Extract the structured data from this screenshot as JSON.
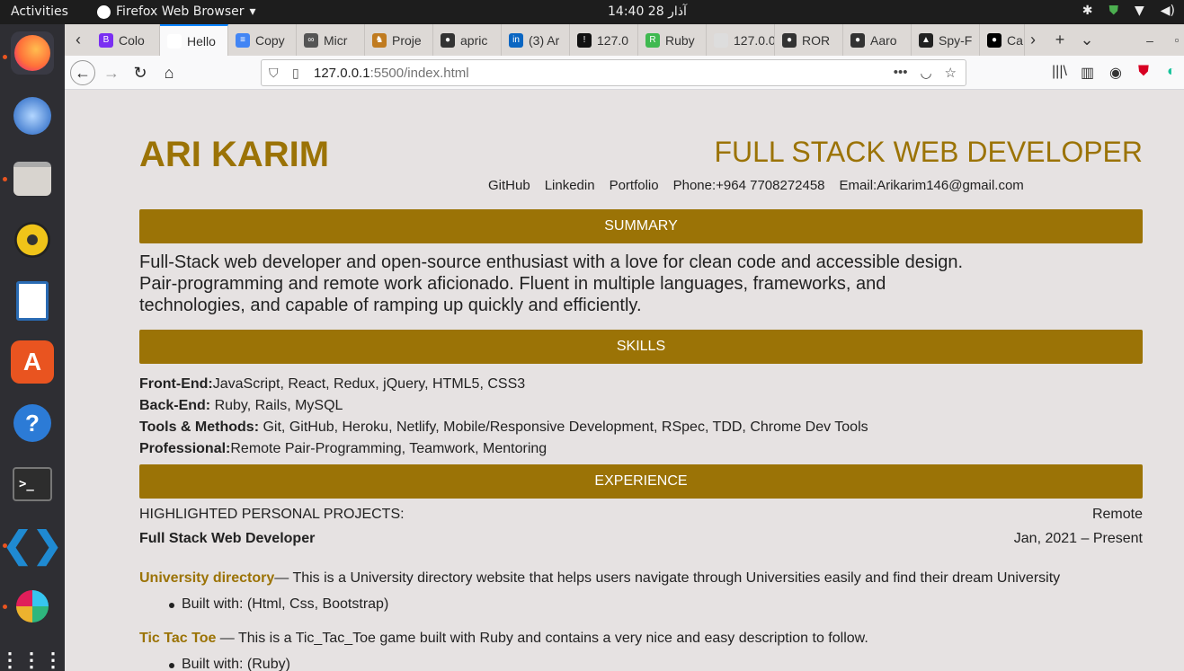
{
  "system_bar": {
    "activities": "Activities",
    "app_name": "Firefox Web Browser",
    "clock": "14:40  28 آذار"
  },
  "tabs": [
    {
      "label": "Colo",
      "color": "#7a2ff2",
      "glyph": "B"
    },
    {
      "label": "Hello",
      "color": "#ffffff",
      "glyph": ""
    },
    {
      "label": "Copy",
      "color": "#4285f4",
      "glyph": "≡"
    },
    {
      "label": "Micr",
      "color": "#555555",
      "glyph": "∞"
    },
    {
      "label": "Proje",
      "color": "#c07b20",
      "glyph": "♞"
    },
    {
      "label": "apric",
      "color": "#333333",
      "glyph": "●"
    },
    {
      "label": "(3) Ar",
      "color": "#0a66c2",
      "glyph": "in"
    },
    {
      "label": "127.0",
      "color": "#111111",
      "glyph": "!"
    },
    {
      "label": "Ruby",
      "color": "#3fb950",
      "glyph": "R"
    },
    {
      "label": "127.0.0.",
      "color": "#dddddd",
      "glyph": ""
    },
    {
      "label": "ROR",
      "color": "#333333",
      "glyph": "●"
    },
    {
      "label": "Aaro",
      "color": "#333333",
      "glyph": "●"
    },
    {
      "label": "Spy-F",
      "color": "#222222",
      "glyph": "▲"
    },
    {
      "label": "Ca",
      "color": "#000000",
      "glyph": "●"
    }
  ],
  "navbar": {
    "url_host": "127.0.0.1",
    "url_rest": ":5500/index.html"
  },
  "resume": {
    "name": "ARI KARIM",
    "role": "FULL STACK WEB DEVELOPER",
    "links": [
      "GitHub",
      "Linkedin",
      "Portfolio",
      "Phone:+964 7708272458",
      "Email:Arikarim146@gmail.com"
    ],
    "summary_heading": "SUMMARY",
    "summary_lines": [
      "Full-Stack web developer and open-source enthusiast with a love for clean code and accessible design.",
      "Pair-programming and remote work aficionado. Fluent in multiple languages, frameworks, and",
      "technologies, and capable of ramping up quickly and efficiently."
    ],
    "skills_heading": "SKILLS",
    "skills": [
      {
        "label": "Front-End:",
        "value": "JavaScript, React, Redux, jQuery, HTML5, CSS3"
      },
      {
        "label": "Back-End:",
        "value": " Ruby, Rails, MySQL"
      },
      {
        "label": "Tools & Methods:",
        "value": " Git, GitHub, Heroku, Netlify, Mobile/Responsive Development, RSpec, TDD, Chrome Dev Tools"
      },
      {
        "label": "Professional:",
        "value": "Remote Pair-Programming, Teamwork, Mentoring"
      }
    ],
    "experience_heading": "EXPERIENCE",
    "exp_title": "HIGHLIGHTED PERSONAL PROJECTS:",
    "exp_location": "Remote",
    "exp_role": "Full Stack Web Developer",
    "exp_dates": "Jan, 2021 – Present",
    "projects": [
      {
        "title": "University directory",
        "desc": "— This is a University directory website that helps users navigate through Universities easily and find their dream University",
        "built": "Built with: (Html, Css, Bootstrap)"
      },
      {
        "title": "Tic Tac Toe",
        "desc": " — This is a Tic_Tac_Toe game built with Ruby and contains a very nice and easy description to follow.",
        "built": "Built with: (Ruby)"
      }
    ]
  }
}
